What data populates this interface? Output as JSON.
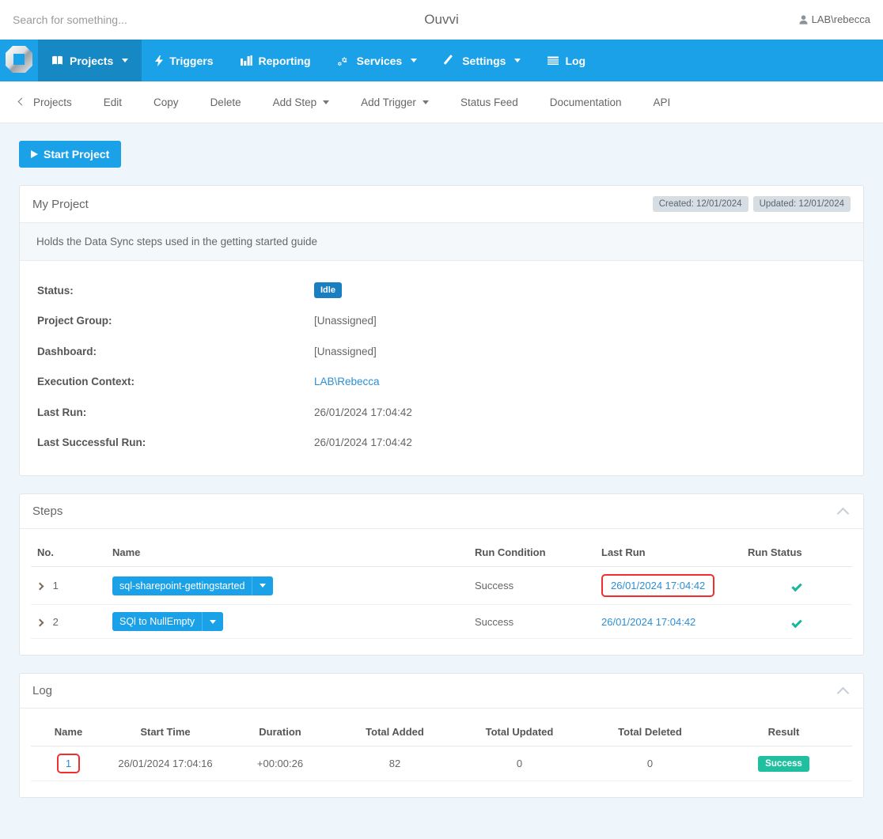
{
  "topbar": {
    "search_placeholder": "Search for something...",
    "search_value": "",
    "brand": "Ouvvi",
    "user": "LAB\\rebecca",
    "user_icon": "user-icon"
  },
  "mainnav": {
    "logo_icon": "ouvvi-logo-icon",
    "items": [
      {
        "label": "Projects",
        "icon": "book-icon",
        "caret": true,
        "active": true
      },
      {
        "label": "Triggers",
        "icon": "bolt-icon",
        "caret": false,
        "active": false
      },
      {
        "label": "Reporting",
        "icon": "bar-chart-icon",
        "caret": false,
        "active": false
      },
      {
        "label": "Services",
        "icon": "gears-icon",
        "caret": true,
        "active": false
      },
      {
        "label": "Settings",
        "icon": "magic-wand-icon",
        "caret": true,
        "active": false
      },
      {
        "label": "Log",
        "icon": "list-icon",
        "caret": false,
        "active": false
      }
    ]
  },
  "subnav": {
    "items": [
      {
        "label": "Projects",
        "back": true,
        "caret": false
      },
      {
        "label": "Edit",
        "back": false,
        "caret": false
      },
      {
        "label": "Copy",
        "back": false,
        "caret": false
      },
      {
        "label": "Delete",
        "back": false,
        "caret": false
      },
      {
        "label": "Add Step",
        "back": false,
        "caret": true
      },
      {
        "label": "Add Trigger",
        "back": false,
        "caret": true
      },
      {
        "label": "Status Feed",
        "back": false,
        "caret": false
      },
      {
        "label": "Documentation",
        "back": false,
        "caret": false
      },
      {
        "label": "API",
        "back": false,
        "caret": false
      }
    ]
  },
  "actions": {
    "start_project": "Start Project",
    "play_icon": "play-icon"
  },
  "project": {
    "title": "My Project",
    "created_badge": "Created: 12/01/2024",
    "updated_badge": "Updated: 12/01/2024",
    "description": "Holds the Data Sync steps used in the getting started guide",
    "details": [
      {
        "label": "Status:",
        "value": "Idle",
        "type": "badge"
      },
      {
        "label": "Project Group:",
        "value": "[Unassigned]",
        "type": "text"
      },
      {
        "label": "Dashboard:",
        "value": "[Unassigned]",
        "type": "text"
      },
      {
        "label": "Execution Context:",
        "value": "LAB\\Rebecca",
        "type": "link"
      },
      {
        "label": "Last Run:",
        "value": "26/01/2024 17:04:42",
        "type": "text"
      },
      {
        "label": "Last Successful Run:",
        "value": "26/01/2024 17:04:42",
        "type": "text"
      }
    ]
  },
  "steps": {
    "title": "Steps",
    "collapse_icon": "chevron-up-icon",
    "columns": [
      "No.",
      "Name",
      "Run Condition",
      "Last Run",
      "Run Status"
    ],
    "rows": [
      {
        "no": "1",
        "name": "sql-sharepoint-gettingstarted",
        "run_condition": "Success",
        "last_run": "26/01/2024 17:04:42",
        "run_status": "check-icon",
        "highlight_last_run": true
      },
      {
        "no": "2",
        "name": "SQl to NullEmpty",
        "run_condition": "Success",
        "last_run": "26/01/2024 17:04:42",
        "run_status": "check-icon",
        "highlight_last_run": false
      }
    ]
  },
  "log": {
    "title": "Log",
    "collapse_icon": "chevron-up-icon",
    "columns": [
      "Name",
      "Start Time",
      "Duration",
      "Total Added",
      "Total Updated",
      "Total Deleted",
      "Result"
    ],
    "rows": [
      {
        "name": "1",
        "start_time": "26/01/2024 17:04:16",
        "duration": "+00:00:26",
        "total_added": "82",
        "total_updated": "0",
        "total_deleted": "0",
        "result": "Success",
        "highlight_name": true
      }
    ]
  },
  "colors": {
    "brand_blue": "#1ba1e8",
    "brand_blue_dark": "#1688c4",
    "page_bg": "#eef5fb",
    "link_blue": "#2c8fd4",
    "success_green": "#1fbfa0",
    "check_green": "#16b79b",
    "highlight_red": "#f0302e",
    "badge_gray": "#d6dde3",
    "idle_blue": "#1a7fc1"
  }
}
